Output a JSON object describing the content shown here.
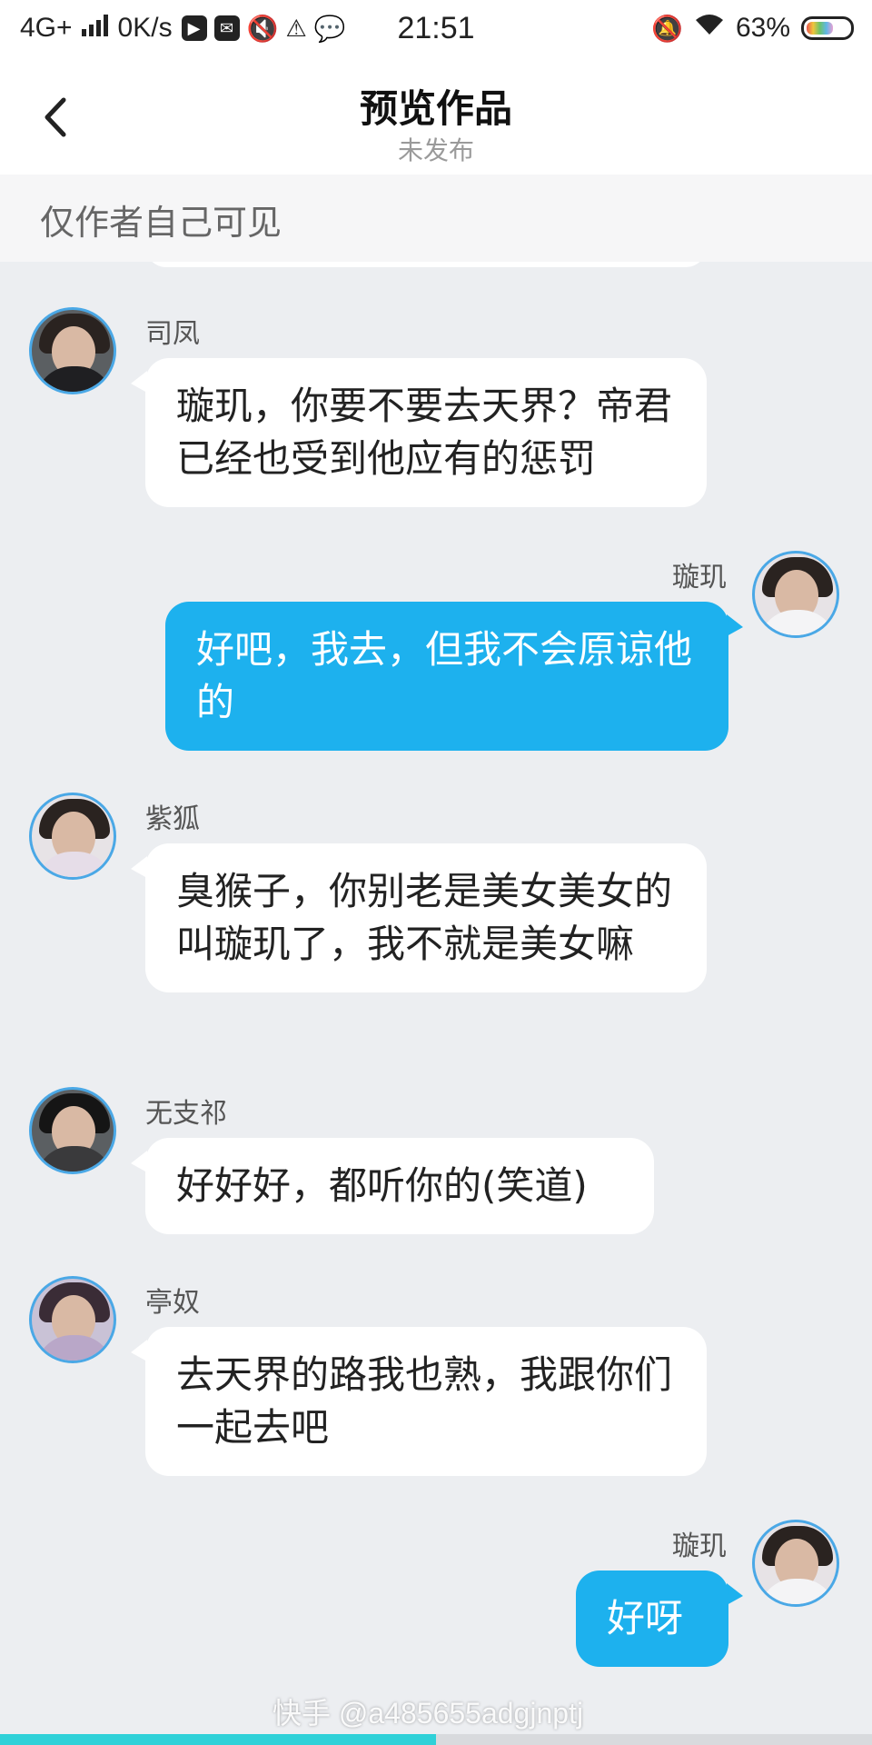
{
  "status_bar": {
    "network": "4G+",
    "speed": "0K/s",
    "time": "21:51",
    "battery": "63%",
    "battery_level": 0.63,
    "icons": [
      "signal-icon",
      "play-icon",
      "mail-icon",
      "mute-icon",
      "data-icon",
      "chat-icon",
      "silent-bell-icon",
      "wifi-icon",
      "battery-icon"
    ]
  },
  "nav": {
    "title": "预览作品",
    "subtitle": "未发布",
    "back_icon": "chevron-left-icon"
  },
  "notice": "仅作者自己可见",
  "messages": [
    {
      "side": "left",
      "sender": "司凤",
      "text": "璇玑，你要不要去天界？帝君已经也受到他应有的惩罚"
    },
    {
      "side": "right",
      "sender": "璇玑",
      "text": "好吧，我去，但我不会原谅他的"
    },
    {
      "side": "left",
      "sender": "紫狐",
      "text": "臭猴子，你别老是美女美女的叫璇玑了，我不就是美女嘛"
    },
    {
      "side": "left",
      "sender": "无支祁",
      "text": "好好好，都听你的(笑道)"
    },
    {
      "side": "left",
      "sender": "亭奴",
      "text": "去天界的路我也熟，我跟你们一起去吧"
    },
    {
      "side": "right",
      "sender": "璇玑",
      "text": "好呀"
    }
  ],
  "watermark": "快手 @a485655adgjnptj",
  "playback_progress": 0.5,
  "colors": {
    "bubble_right": "#1db1ee",
    "bubble_left": "#ffffff",
    "chat_bg": "#eceef1",
    "avatar_ring": "#4aa8e6",
    "progress": "#2fd1d8"
  }
}
